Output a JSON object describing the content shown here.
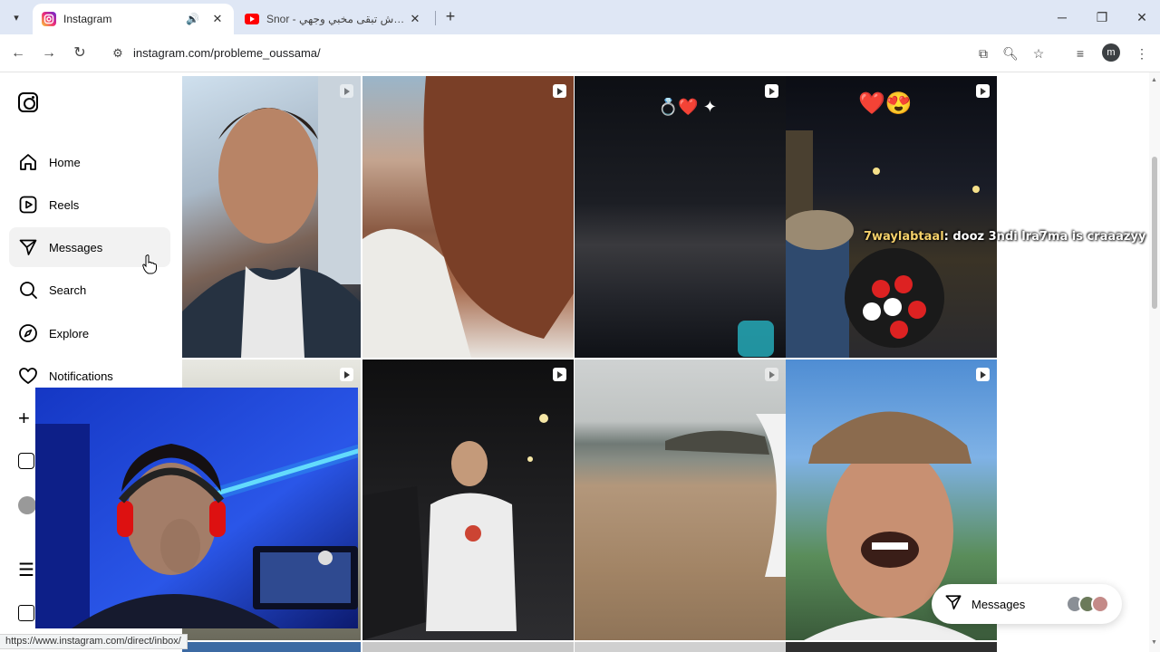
{
  "browser": {
    "tabs": [
      {
        "title": "Instagram",
        "active": true
      },
      {
        "title": "Snor - ش لاش تبقى مخبي وجهي",
        "active": false
      }
    ],
    "url": "instagram.com/probleme_oussama/",
    "profile_initial": "m",
    "status_url": "https://www.instagram.com/direct/inbox/"
  },
  "sidebar": {
    "items": [
      {
        "label": "Home",
        "icon": "home-icon"
      },
      {
        "label": "Reels",
        "icon": "reels-icon"
      },
      {
        "label": "Messages",
        "icon": "messages-icon"
      },
      {
        "label": "Search",
        "icon": "search-icon"
      },
      {
        "label": "Explore",
        "icon": "explore-icon"
      },
      {
        "label": "Notifications",
        "icon": "heart-icon"
      }
    ]
  },
  "grid": {
    "tiles": [
      {
        "description_icon": "pin-icon"
      },
      {
        "description_icon": "reel-icon"
      },
      {
        "overlay_text": "💍❤️ ✦",
        "description_icon": "reel-icon"
      },
      {
        "overlay_text": "❤️😍",
        "description_icon": "reel-icon"
      },
      {
        "description_icon": "reel-icon"
      },
      {
        "description_icon": "reel-icon"
      },
      {
        "description_icon": "reel-icon"
      },
      {
        "description_icon": "reel-icon"
      }
    ]
  },
  "chat_overlay": {
    "user": "7waylabtaal",
    "message": ": dooz 3ndi lra7ma is craaazyy"
  },
  "messages_widget": {
    "label": "Messages"
  },
  "colors": {
    "tabbar_bg": "#dfe7f5",
    "instagram_accent": "#e1306c",
    "youtube_red": "#ff0000",
    "chat_user": "#f5d16b"
  }
}
